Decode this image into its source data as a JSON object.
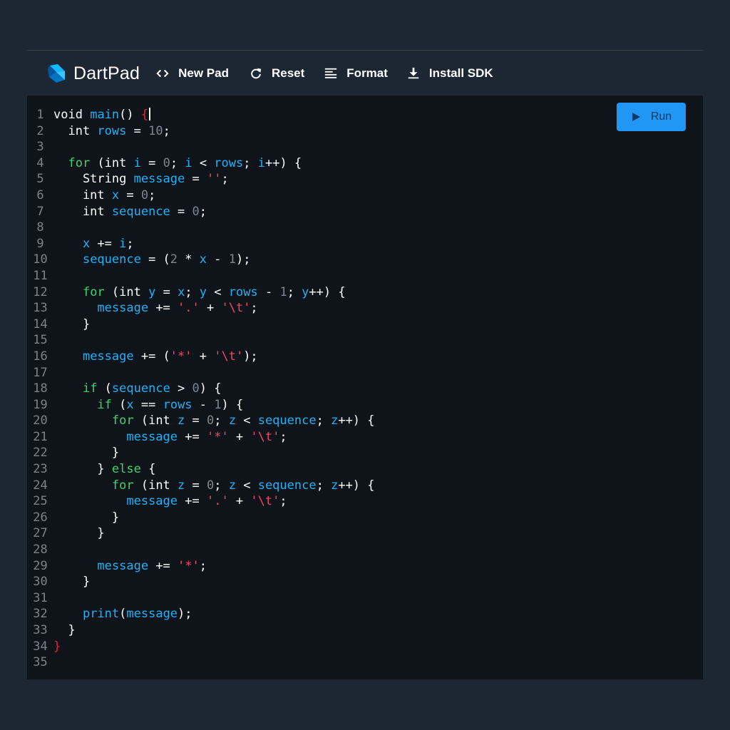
{
  "app": {
    "title": "DartPad"
  },
  "toolbar": {
    "buttons": [
      {
        "label": "New Pad",
        "icon": "code-brackets-icon"
      },
      {
        "label": "Reset",
        "icon": "refresh-icon"
      },
      {
        "label": "Format",
        "icon": "format-lines-icon"
      },
      {
        "label": "Install SDK",
        "icon": "download-icon"
      }
    ]
  },
  "editor": {
    "run_label": "Run",
    "lines": [
      [
        [
          "void",
          "kw"
        ],
        [
          " ",
          "op"
        ],
        [
          "main",
          "id"
        ],
        [
          "() ",
          "op"
        ],
        [
          "{",
          "red"
        ]
      ],
      [
        [
          "  int ",
          "kw"
        ],
        [
          "rows",
          "id"
        ],
        [
          " = ",
          "op"
        ],
        [
          "10",
          "num"
        ],
        [
          ";",
          "op"
        ]
      ],
      [],
      [
        [
          "  ",
          "op"
        ],
        [
          "for",
          "ctl"
        ],
        [
          " (int ",
          "kw"
        ],
        [
          "i",
          "id"
        ],
        [
          " = ",
          "op"
        ],
        [
          "0",
          "num"
        ],
        [
          "; ",
          "op"
        ],
        [
          "i",
          "id"
        ],
        [
          " < ",
          "op"
        ],
        [
          "rows",
          "id"
        ],
        [
          "; ",
          "op"
        ],
        [
          "i",
          "id"
        ],
        [
          "++) {",
          "op"
        ]
      ],
      [
        [
          "    String ",
          "kw"
        ],
        [
          "message",
          "id"
        ],
        [
          " = ",
          "op"
        ],
        [
          "''",
          "str"
        ],
        [
          ";",
          "op"
        ]
      ],
      [
        [
          "    int ",
          "kw"
        ],
        [
          "x",
          "id"
        ],
        [
          " = ",
          "op"
        ],
        [
          "0",
          "num"
        ],
        [
          ";",
          "op"
        ]
      ],
      [
        [
          "    int ",
          "kw"
        ],
        [
          "sequence",
          "id"
        ],
        [
          " = ",
          "op"
        ],
        [
          "0",
          "num"
        ],
        [
          ";",
          "op"
        ]
      ],
      [],
      [
        [
          "    ",
          "op"
        ],
        [
          "x",
          "id"
        ],
        [
          " += ",
          "op"
        ],
        [
          "i",
          "id"
        ],
        [
          ";",
          "op"
        ]
      ],
      [
        [
          "    ",
          "op"
        ],
        [
          "sequence",
          "id"
        ],
        [
          " = (",
          "op"
        ],
        [
          "2",
          "num"
        ],
        [
          " * ",
          "op"
        ],
        [
          "x",
          "id"
        ],
        [
          " - ",
          "op"
        ],
        [
          "1",
          "num"
        ],
        [
          ");",
          "op"
        ]
      ],
      [],
      [
        [
          "    ",
          "op"
        ],
        [
          "for",
          "ctl"
        ],
        [
          " (int ",
          "kw"
        ],
        [
          "y",
          "id"
        ],
        [
          " = ",
          "op"
        ],
        [
          "x",
          "id"
        ],
        [
          "; ",
          "op"
        ],
        [
          "y",
          "id"
        ],
        [
          " < ",
          "op"
        ],
        [
          "rows",
          "id"
        ],
        [
          " - ",
          "op"
        ],
        [
          "1",
          "num"
        ],
        [
          "; ",
          "op"
        ],
        [
          "y",
          "id"
        ],
        [
          "++) {",
          "op"
        ]
      ],
      [
        [
          "      ",
          "op"
        ],
        [
          "message",
          "id"
        ],
        [
          " += ",
          "op"
        ],
        [
          "'.'",
          "str"
        ],
        [
          " + ",
          "op"
        ],
        [
          "'\\t'",
          "str"
        ],
        [
          ";",
          "op"
        ]
      ],
      [
        [
          "    }",
          "op"
        ]
      ],
      [],
      [
        [
          "    ",
          "op"
        ],
        [
          "message",
          "id"
        ],
        [
          " += (",
          "op"
        ],
        [
          "'*'",
          "str"
        ],
        [
          " + ",
          "op"
        ],
        [
          "'\\t'",
          "str"
        ],
        [
          ");",
          "op"
        ]
      ],
      [],
      [
        [
          "    ",
          "op"
        ],
        [
          "if",
          "ctl"
        ],
        [
          " (",
          "op"
        ],
        [
          "sequence",
          "id"
        ],
        [
          " > ",
          "op"
        ],
        [
          "0",
          "num"
        ],
        [
          ") {",
          "op"
        ]
      ],
      [
        [
          "      ",
          "op"
        ],
        [
          "if",
          "ctl"
        ],
        [
          " (",
          "op"
        ],
        [
          "x",
          "id"
        ],
        [
          " == ",
          "op"
        ],
        [
          "rows",
          "id"
        ],
        [
          " - ",
          "op"
        ],
        [
          "1",
          "num"
        ],
        [
          ") {",
          "op"
        ]
      ],
      [
        [
          "        ",
          "op"
        ],
        [
          "for",
          "ctl"
        ],
        [
          " (int ",
          "kw"
        ],
        [
          "z",
          "id"
        ],
        [
          " = ",
          "op"
        ],
        [
          "0",
          "num"
        ],
        [
          "; ",
          "op"
        ],
        [
          "z",
          "id"
        ],
        [
          " < ",
          "op"
        ],
        [
          "sequence",
          "id"
        ],
        [
          "; ",
          "op"
        ],
        [
          "z",
          "id"
        ],
        [
          "++) {",
          "op"
        ]
      ],
      [
        [
          "          ",
          "op"
        ],
        [
          "message",
          "id"
        ],
        [
          " += ",
          "op"
        ],
        [
          "'*'",
          "str"
        ],
        [
          " + ",
          "op"
        ],
        [
          "'\\t'",
          "str"
        ],
        [
          ";",
          "op"
        ]
      ],
      [
        [
          "        }",
          "op"
        ]
      ],
      [
        [
          "      } ",
          "op"
        ],
        [
          "else",
          "ctl"
        ],
        [
          " {",
          "op"
        ]
      ],
      [
        [
          "        ",
          "op"
        ],
        [
          "for",
          "ctl"
        ],
        [
          " (int ",
          "kw"
        ],
        [
          "z",
          "id"
        ],
        [
          " = ",
          "op"
        ],
        [
          "0",
          "num"
        ],
        [
          "; ",
          "op"
        ],
        [
          "z",
          "id"
        ],
        [
          " < ",
          "op"
        ],
        [
          "sequence",
          "id"
        ],
        [
          "; ",
          "op"
        ],
        [
          "z",
          "id"
        ],
        [
          "++) {",
          "op"
        ]
      ],
      [
        [
          "          ",
          "op"
        ],
        [
          "message",
          "id"
        ],
        [
          " += ",
          "op"
        ],
        [
          "'.'",
          "str"
        ],
        [
          " + ",
          "op"
        ],
        [
          "'\\t'",
          "str"
        ],
        [
          ";",
          "op"
        ]
      ],
      [
        [
          "        }",
          "op"
        ]
      ],
      [
        [
          "      }",
          "op"
        ]
      ],
      [],
      [
        [
          "      ",
          "op"
        ],
        [
          "message",
          "id"
        ],
        [
          " += ",
          "op"
        ],
        [
          "'*'",
          "str"
        ],
        [
          ";",
          "op"
        ]
      ],
      [
        [
          "    }",
          "op"
        ]
      ],
      [],
      [
        [
          "    ",
          "op"
        ],
        [
          "print",
          "id"
        ],
        [
          "(",
          "op"
        ],
        [
          "message",
          "id"
        ],
        [
          ");",
          "op"
        ]
      ],
      [
        [
          "  }",
          "op"
        ]
      ],
      [
        [
          "}",
          "red"
        ]
      ],
      []
    ]
  },
  "colors": {
    "background": "#1d2733",
    "editor_bg": "#0f141b",
    "run_button": "#2196f3",
    "identifier": "#1fb1f4",
    "control": "#3fd36c",
    "string": "#f0466a",
    "number": "#7d8690"
  }
}
